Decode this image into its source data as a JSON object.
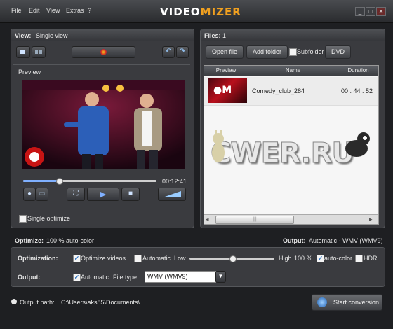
{
  "titlebar": {
    "menu": [
      "File",
      "Edit",
      "View",
      "Extras",
      "?"
    ],
    "logo_part1": "VIDEO",
    "logo_part2": "MIZER",
    "min": "_",
    "max": "□",
    "close": "✕"
  },
  "left_panel": {
    "view_label": "View:",
    "view_value": "Single view",
    "preview_label": "Preview",
    "time": "00:12:41",
    "seek_fraction": 0.27,
    "single_optimize_label": "Single optimize"
  },
  "right_panel": {
    "files_label": "Files:",
    "files_count": "1",
    "open_file": "Open file",
    "add_folder": "Add folder",
    "subfolder": "Subfolder",
    "dvd": "DVD",
    "columns": [
      "Preview",
      "Name",
      "Duration"
    ],
    "rows": [
      {
        "name": "Comedy_club_284",
        "duration": "00 : 44 : 52"
      }
    ],
    "watermark": "CWER.RU",
    "scroll_left": "◂",
    "scroll_right": "▸",
    "scroll_grip": "|||"
  },
  "optimize_bar": {
    "label": "Optimize:",
    "value": "100 % auto-color",
    "output_label": "Output:",
    "output_value": "Automatic - WMV (WMV9)"
  },
  "options": {
    "optimization_label": "Optimization:",
    "optimize_videos": "Optimize videos",
    "automatic": "Automatic",
    "low": "Low",
    "high": "High",
    "percent": "100",
    "percent_unit": "%",
    "slider_fraction": 0.5,
    "auto_color": "auto-color",
    "hdr": "HDR",
    "output_label": "Output:",
    "output_automatic": "Automatic",
    "file_type_label": "File type:",
    "file_type_value": "WMV (WMV9)"
  },
  "footer": {
    "output_path_label": "Output path:",
    "output_path": "C:\\Users\\aks85\\Documents\\",
    "start_conversion": "Start conversion"
  }
}
